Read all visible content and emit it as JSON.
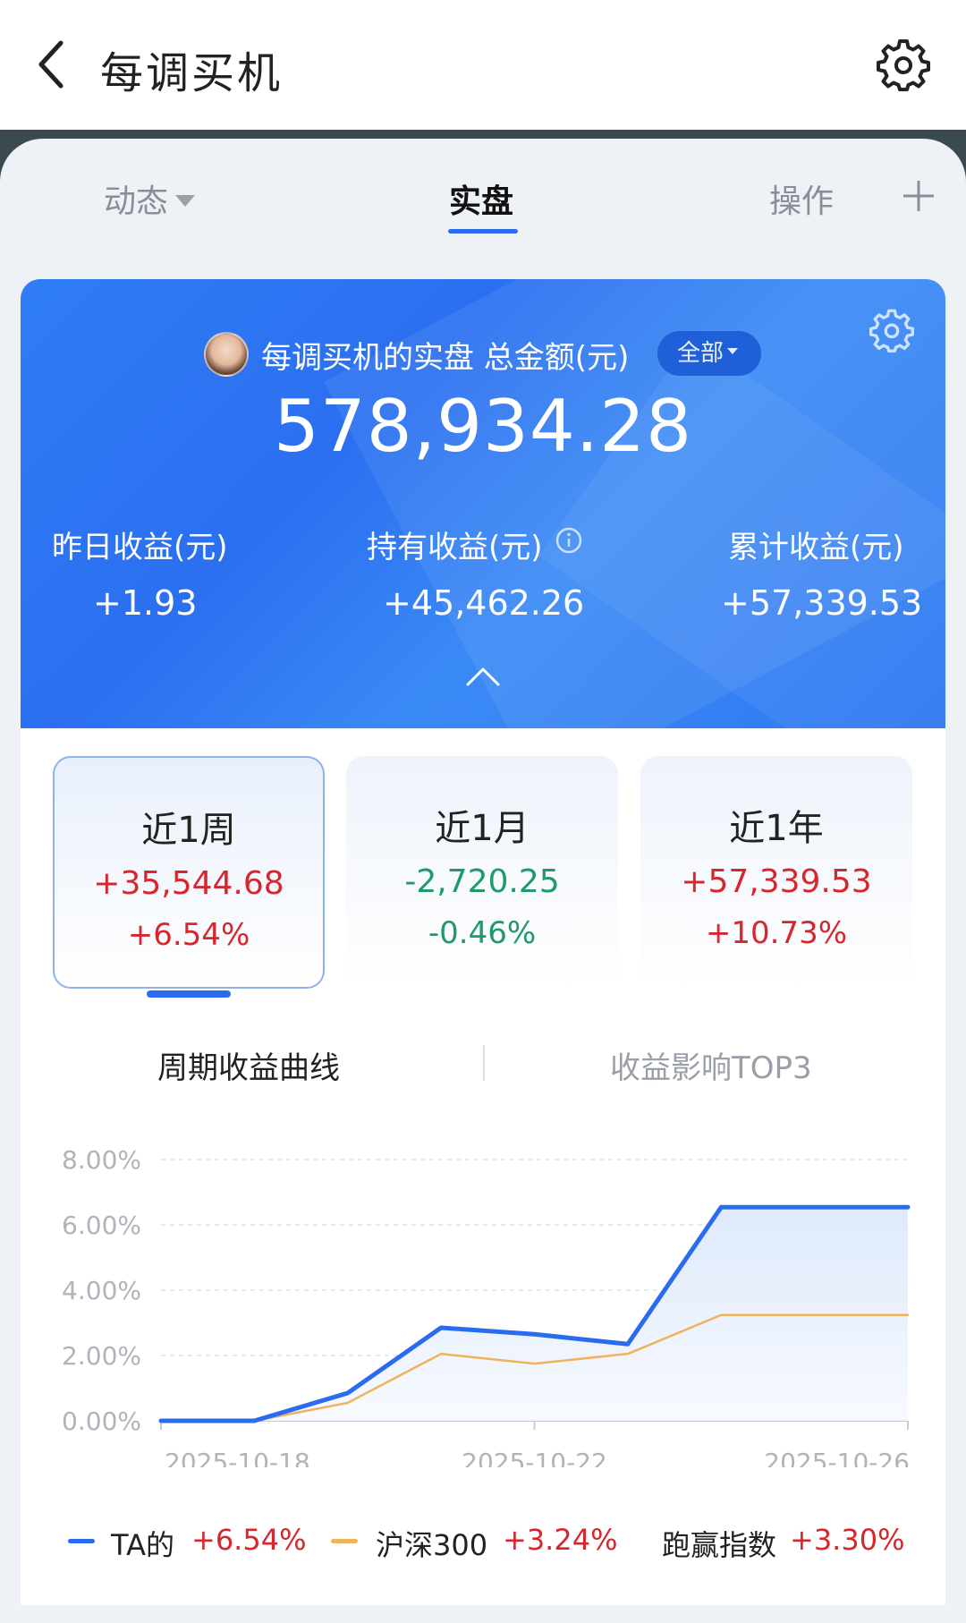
{
  "header": {
    "title": "每调买机"
  },
  "tabs": {
    "dongtai": "动态",
    "shipan": "实盘",
    "caozuo": "操作"
  },
  "summary": {
    "caption": "每调买机的实盘  总金额(元)",
    "scope": "全部",
    "total": "578,934.28",
    "yesterday_label": "昨日收益(元)",
    "yesterday_value": "+1.93",
    "holding_label": "持有收益(元)",
    "holding_value": "+45,462.26",
    "cumulative_label": "累计收益(元)",
    "cumulative_value": "+57,339.53"
  },
  "periods": [
    {
      "title": "近1周",
      "amount": "+35,544.68",
      "pct": "+6.54%",
      "trend": "up",
      "active": true
    },
    {
      "title": "近1月",
      "amount": "-2,720.25",
      "pct": "-0.46%",
      "trend": "down",
      "active": false
    },
    {
      "title": "近1年",
      "amount": "+57,339.53",
      "pct": "+10.73%",
      "trend": "up",
      "active": false
    }
  ],
  "chart_tabs": {
    "curve": "周期收益曲线",
    "top3": "收益影响TOP3"
  },
  "chart_data": {
    "type": "line",
    "x": [
      "2025-10-18",
      "2025-10-19",
      "2025-10-20",
      "2025-10-21",
      "2025-10-22",
      "2025-10-23",
      "2025-10-24",
      "2025-10-25",
      "2025-10-26"
    ],
    "x_tick_labels": [
      "2025-10-18",
      "2025-10-22",
      "2025-10-26"
    ],
    "y_tick_labels": [
      "8.00%",
      "6.00%",
      "4.00%",
      "2.00%",
      "0.00%"
    ],
    "ylim": [
      0,
      8
    ],
    "series": [
      {
        "name": "TA的",
        "color": "#2a6cf0",
        "values": [
          0.0,
          0.0,
          0.85,
          2.85,
          2.65,
          2.35,
          6.54,
          6.54,
          6.54
        ]
      },
      {
        "name": "沪深300",
        "color": "#f0b25a",
        "values": [
          0.0,
          0.0,
          0.55,
          2.05,
          1.75,
          2.05,
          3.24,
          3.24,
          3.24
        ]
      }
    ],
    "grid": true
  },
  "legend": {
    "ta_name": "TA的",
    "ta_value": "+6.54%",
    "hs_name": "沪深300",
    "hs_value": "+3.24%",
    "beat_name": "跑赢指数",
    "beat_value": "+3.30%"
  },
  "colors": {
    "accent": "#2a6cf0",
    "up": "#d6262e",
    "down": "#1f9a6a",
    "benchmark": "#f0b25a"
  }
}
